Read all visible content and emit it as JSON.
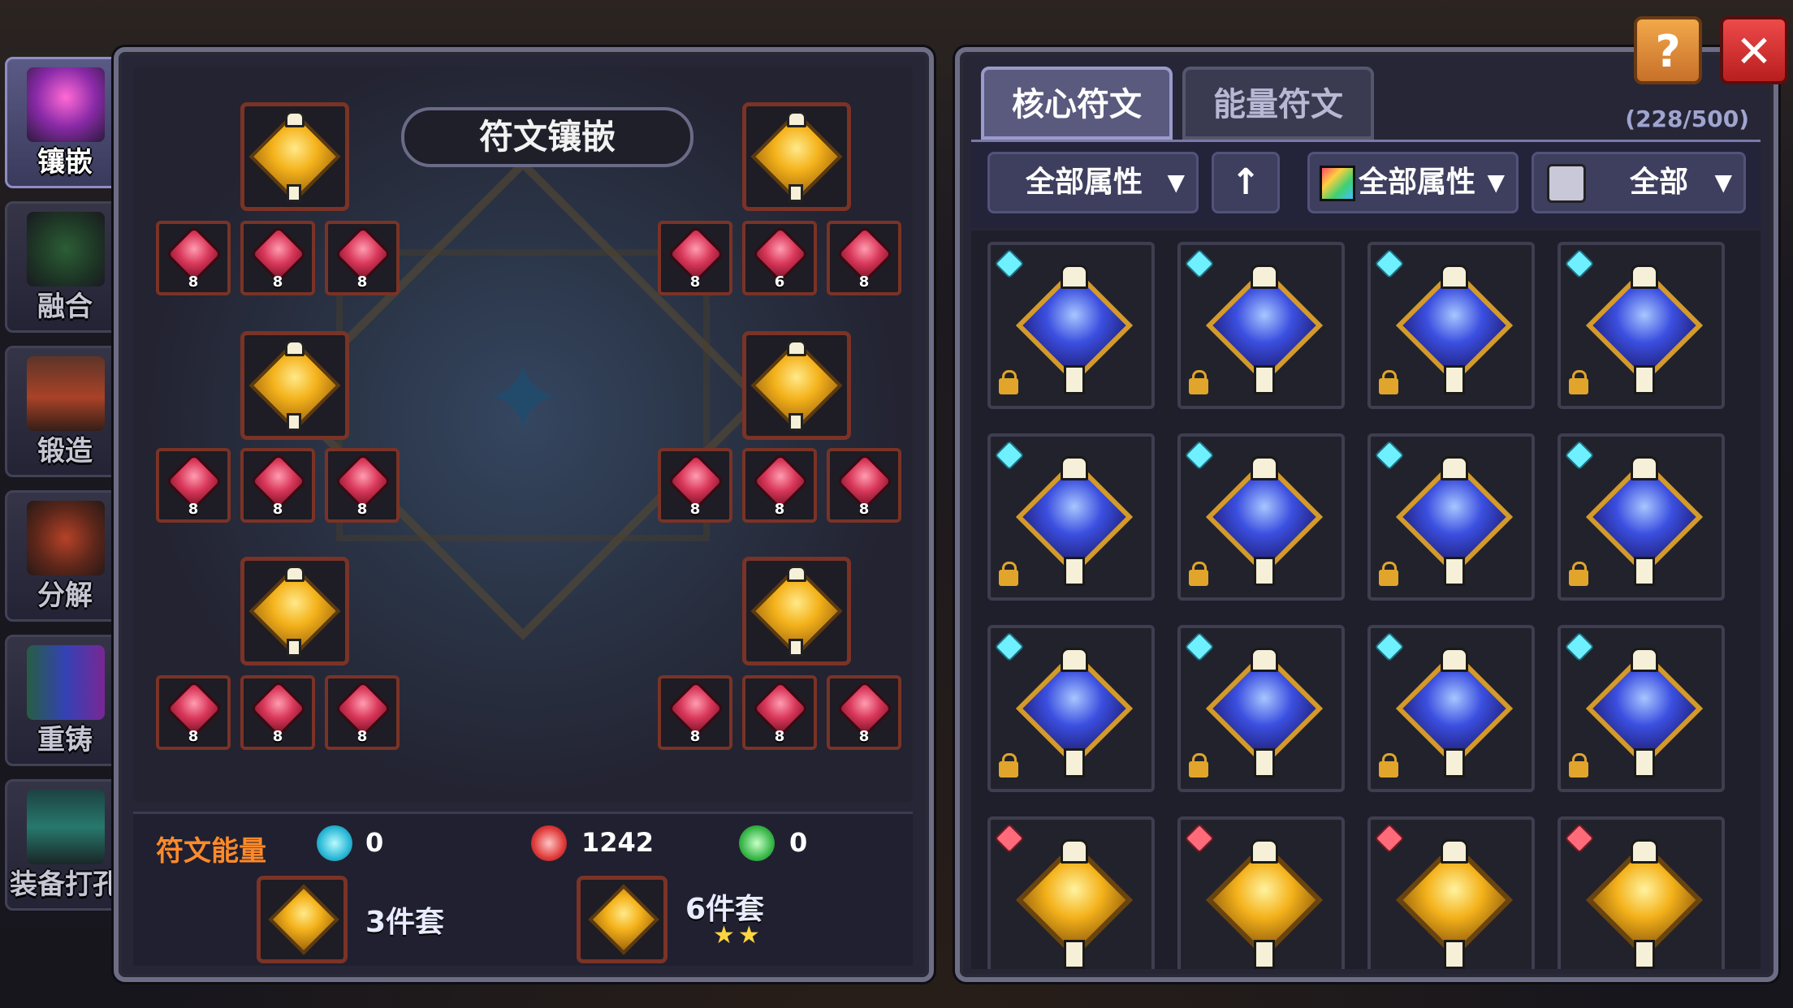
{
  "sidebar": {
    "items": [
      {
        "label": "镶嵌",
        "icon": "inlay-icon",
        "active": true
      },
      {
        "label": "融合",
        "icon": "fusion-icon",
        "active": false
      },
      {
        "label": "锻造",
        "icon": "forge-icon",
        "active": false
      },
      {
        "label": "分解",
        "icon": "decompose-icon",
        "active": false
      },
      {
        "label": "重铸",
        "icon": "recast-icon",
        "active": false
      },
      {
        "label": "装备打孔",
        "icon": "socket-icon",
        "active": false
      }
    ]
  },
  "left_panel": {
    "title": "符文镶嵌",
    "small_rune_levels": [
      "8",
      "8",
      "8",
      "8",
      "6",
      "8",
      "8",
      "8",
      "8",
      "8",
      "8",
      "8",
      "8",
      "8",
      "8",
      "8",
      "8",
      "8"
    ],
    "energy": {
      "label": "符文能量",
      "cyan_value": "0",
      "red_value": "1242",
      "green_value": "0"
    },
    "sets": [
      {
        "label": "3件套",
        "stars": ""
      },
      {
        "label": "6件套",
        "stars": "★★"
      }
    ]
  },
  "right_panel": {
    "tabs": [
      "核心符文",
      "能量符文"
    ],
    "active_tab": "核心符文",
    "count": "(228/500)",
    "filters": {
      "attribute_filter": "全部属性",
      "sort_icon": "arrow-up-icon",
      "color_filter": "全部属性",
      "type_filter": "全部"
    },
    "grid": [
      {
        "type": "blue",
        "mark": "cyan"
      },
      {
        "type": "blue",
        "mark": "cyan"
      },
      {
        "type": "blue",
        "mark": "cyan"
      },
      {
        "type": "blue",
        "mark": "cyan"
      },
      {
        "type": "blue",
        "mark": "cyan"
      },
      {
        "type": "blue",
        "mark": "cyan"
      },
      {
        "type": "blue",
        "mark": "cyan"
      },
      {
        "type": "blue",
        "mark": "cyan"
      },
      {
        "type": "blue",
        "mark": "cyan"
      },
      {
        "type": "blue",
        "mark": "cyan"
      },
      {
        "type": "blue",
        "mark": "cyan"
      },
      {
        "type": "blue",
        "mark": "cyan"
      },
      {
        "type": "gold",
        "mark": "red"
      },
      {
        "type": "gold",
        "mark": "red"
      },
      {
        "type": "gold",
        "mark": "red"
      },
      {
        "type": "gold",
        "mark": "red"
      }
    ]
  },
  "buttons": {
    "help": "?",
    "close": "✕"
  },
  "colors": {
    "energy_label": "#ff8a2a",
    "slot_border": "#7a3326",
    "panel_border": "#6d6d86",
    "help": "#f2a84a",
    "close": "#ee4a4a"
  }
}
